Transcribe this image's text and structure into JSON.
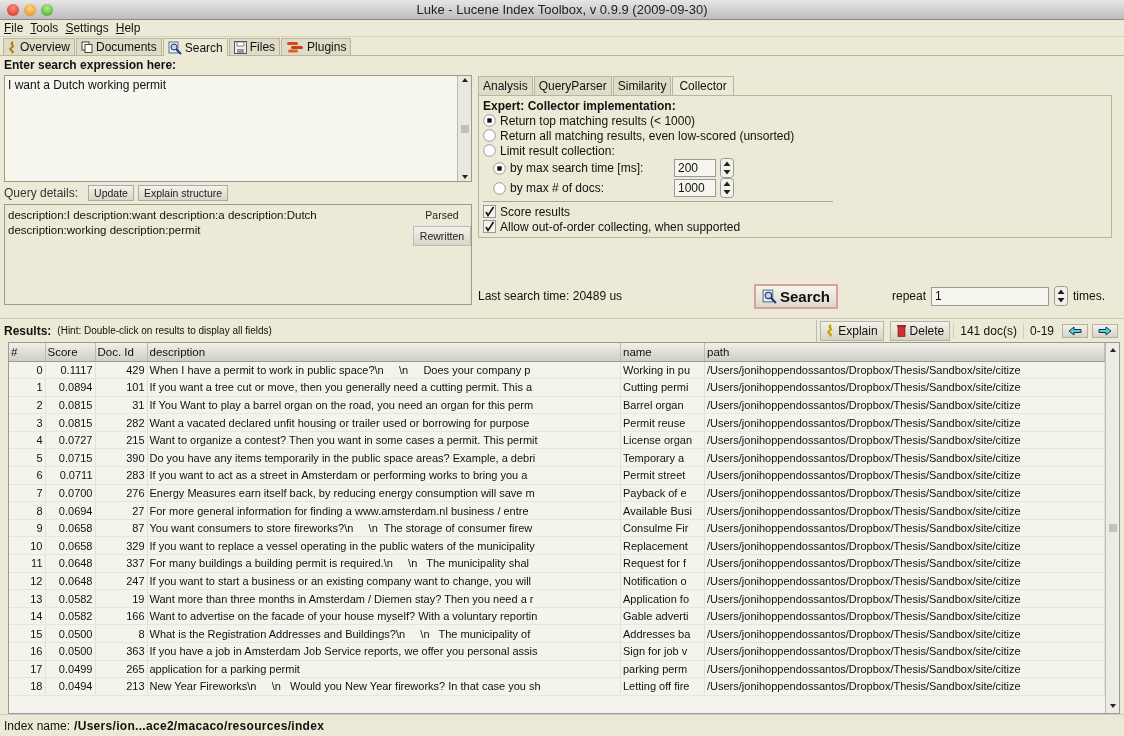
{
  "window": {
    "title": "Luke - Lucene Index Toolbox, v 0.9.9 (2009-09-30)"
  },
  "menu": [
    "File",
    "Tools",
    "Settings",
    "Help"
  ],
  "tabs": [
    {
      "label": "Overview",
      "selected": false
    },
    {
      "label": "Documents",
      "selected": false
    },
    {
      "label": "Search",
      "selected": true
    },
    {
      "label": "Files",
      "selected": false
    },
    {
      "label": "Plugins",
      "selected": false
    }
  ],
  "search": {
    "heading": "Enter search expression here:",
    "query": "I want a Dutch working permit",
    "details_label": "Query details:",
    "buttons": [
      "Update",
      "Explain structure"
    ],
    "parsed": "description:I description:want description:a description:Dutch description:working description:permit",
    "views": [
      {
        "label": "Parsed",
        "selected": true
      },
      {
        "label": "Rewritten",
        "selected": false
      }
    ]
  },
  "settings_tabs": [
    {
      "label": "Analysis",
      "selected": false
    },
    {
      "label": "QueryParser",
      "selected": false
    },
    {
      "label": "Similarity",
      "selected": false
    },
    {
      "label": "Collector",
      "selected": true
    }
  ],
  "collector": {
    "heading": "Expert: Collector implementation:",
    "options": [
      {
        "label": "Return top matching results (< 1000)",
        "selected": true
      },
      {
        "label": "Return all matching results, even low-scored (unsorted)",
        "selected": false
      },
      {
        "label": "Limit result collection:",
        "selected": false
      }
    ],
    "limits": [
      {
        "label": "by max search time [ms]:",
        "value": "200",
        "selected": true
      },
      {
        "label": "by max # of docs:",
        "value": "1000",
        "selected": false
      }
    ],
    "checks": [
      {
        "label": "Score results",
        "checked": true
      },
      {
        "label": "Allow out-of-order collecting, when supported",
        "checked": true
      }
    ]
  },
  "search_bar": {
    "last_time": "Last search time: 20489 us",
    "button": "Search",
    "repeat_label": "repeat",
    "repeat_value": "1",
    "times_label": "times."
  },
  "results": {
    "label": "Results:",
    "hint": "(Hint: Double-click on results to display all fields)",
    "explain": "Explain",
    "delete": "Delete",
    "count": "141 doc(s)",
    "range": "0-19",
    "columns": [
      "#",
      "Score",
      "Doc. Id",
      "description",
      "name",
      "path"
    ],
    "rows": [
      [
        "0",
        "0.1117",
        "429",
        "When I have a permit to work in public space?\\n     \\n     Does your company p",
        "Working in pu",
        "/Users/jonihoppendossantos/Dropbox/Thesis/Sandbox/site/citize"
      ],
      [
        "1",
        "0.0894",
        "101",
        "If you want a tree cut or move, then you generally need a cutting permit. This a",
        "Cutting permi",
        "/Users/jonihoppendossantos/Dropbox/Thesis/Sandbox/site/citize"
      ],
      [
        "2",
        "0.0815",
        "31",
        "If You Want to play a barrel organ on the road, you need an organ for this perm",
        "Barrel organ",
        "/Users/jonihoppendossantos/Dropbox/Thesis/Sandbox/site/citize"
      ],
      [
        "3",
        "0.0815",
        "282",
        "Want a vacated declared unfit housing or trailer used or borrowing for purpose",
        "Permit reuse",
        "/Users/jonihoppendossantos/Dropbox/Thesis/Sandbox/site/citize"
      ],
      [
        "4",
        "0.0727",
        "215",
        "Want to organize a contest? Then you want in some cases a permit. This permit",
        "License organ",
        "/Users/jonihoppendossantos/Dropbox/Thesis/Sandbox/site/citize"
      ],
      [
        "5",
        "0.0715",
        "390",
        "Do you have any items temporarily in the public space areas? Example, a debri",
        "Temporary a",
        "/Users/jonihoppendossantos/Dropbox/Thesis/Sandbox/site/citize"
      ],
      [
        "6",
        "0.0711",
        "283",
        "If you want to act as a street in Amsterdam or performing works to bring you a",
        "Permit street",
        "/Users/jonihoppendossantos/Dropbox/Thesis/Sandbox/site/citize"
      ],
      [
        "7",
        "0.0700",
        "276",
        "Energy Measures earn itself back, by reducing energy consumption will save m",
        "Payback of e",
        "/Users/jonihoppendossantos/Dropbox/Thesis/Sandbox/site/citize"
      ],
      [
        "8",
        "0.0694",
        "27",
        "For more general information for finding a www.amsterdam.nl business / entre",
        "Available Busi",
        "/Users/jonihoppendossantos/Dropbox/Thesis/Sandbox/site/citize"
      ],
      [
        "9",
        "0.0658",
        "87",
        "You want consumers to store fireworks?\\n     \\n  The storage of consumer firew",
        "Consulme Fir",
        "/Users/jonihoppendossantos/Dropbox/Thesis/Sandbox/site/citize"
      ],
      [
        "10",
        "0.0658",
        "329",
        "If you want to replace a vessel operating in the public waters of the municipality",
        "Replacement",
        "/Users/jonihoppendossantos/Dropbox/Thesis/Sandbox/site/citize"
      ],
      [
        "11",
        "0.0648",
        "337",
        "For many buildings a building permit is required.\\n     \\n   The municipality shal",
        "Request for f",
        "/Users/jonihoppendossantos/Dropbox/Thesis/Sandbox/site/citize"
      ],
      [
        "12",
        "0.0648",
        "247",
        "If you want to start a business or an existing company want to change, you will",
        "Notification o",
        "/Users/jonihoppendossantos/Dropbox/Thesis/Sandbox/site/citize"
      ],
      [
        "13",
        "0.0582",
        "19",
        "Want more than three months in Amsterdam / Diemen stay? Then you need a r",
        "Application fo",
        "/Users/jonihoppendossantos/Dropbox/Thesis/Sandbox/site/citize"
      ],
      [
        "14",
        "0.0582",
        "166",
        "Want to advertise on the facade of your house myself? With a voluntary reportin",
        "Gable adverti",
        "/Users/jonihoppendossantos/Dropbox/Thesis/Sandbox/site/citize"
      ],
      [
        "15",
        "0.0500",
        "8",
        "What is the Registration Addresses and Buildings?\\n     \\n   The municipality of",
        "Addresses ba",
        "/Users/jonihoppendossantos/Dropbox/Thesis/Sandbox/site/citize"
      ],
      [
        "16",
        "0.0500",
        "363",
        "If you have a job in Amsterdam Job Service reports, we offer you personal assis",
        "Sign for job v",
        "/Users/jonihoppendossantos/Dropbox/Thesis/Sandbox/site/citize"
      ],
      [
        "17",
        "0.0499",
        "265",
        "application for a parking permit",
        "parking perm",
        "/Users/jonihoppendossantos/Dropbox/Thesis/Sandbox/site/citize"
      ],
      [
        "18",
        "0.0494",
        "213",
        "New Year Fireworks\\n     \\n   Would you New Year fireworks? In that case you sh",
        "Letting off fire",
        "/Users/jonihoppendossantos/Dropbox/Thesis/Sandbox/site/citize"
      ]
    ]
  },
  "status": {
    "label": "Index name:",
    "value": "/Users/ion...ace2/macaco/resources/index"
  }
}
